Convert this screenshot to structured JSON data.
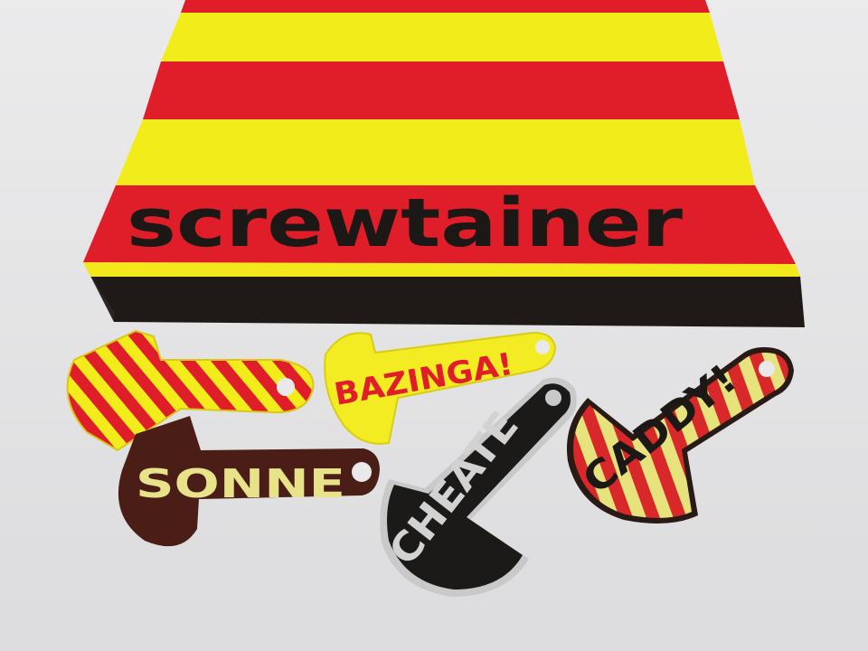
{
  "scene": {
    "description_free": true,
    "box_label": "screwtainer",
    "tokens": [
      {
        "name": "token-striped",
        "label": ""
      },
      {
        "name": "token-bazinga",
        "label": "BAZINGA!"
      },
      {
        "name": "token-sonne",
        "label": "SONNE"
      },
      {
        "name": "token-cheater",
        "label": "CHEATE"
      },
      {
        "name": "token-caddy",
        "label": "CADDY!"
      }
    ]
  },
  "colors": {
    "background": "#e9e9ea",
    "red": "#e01e2a",
    "yellow": "#f2ec1a",
    "black": "#1b1816",
    "pale_yellow": "#ece59a",
    "brown": "#4a1e16",
    "grey": "#d6d6d6"
  }
}
